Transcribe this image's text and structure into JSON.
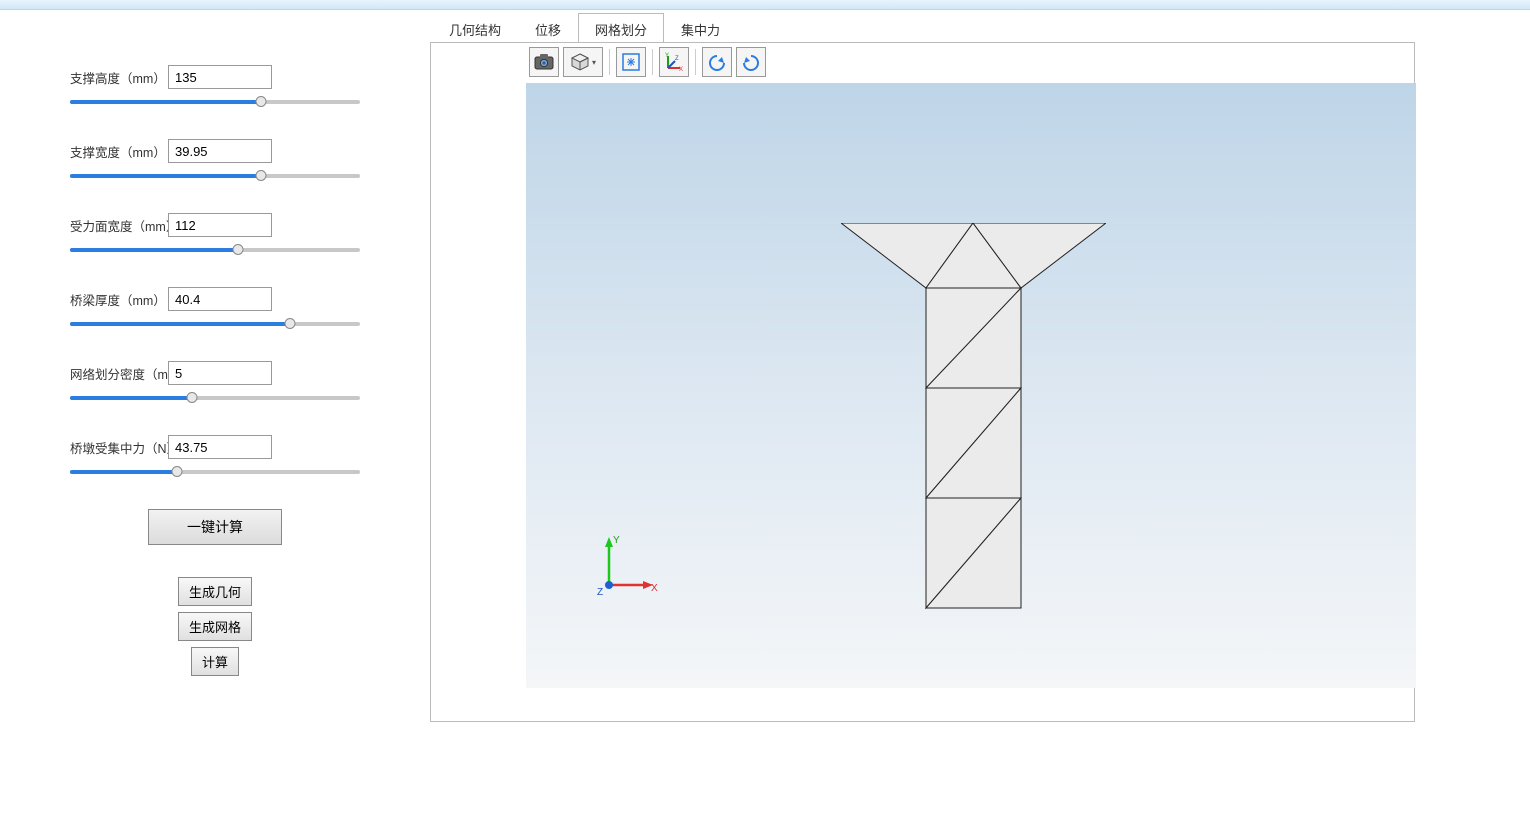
{
  "sidebar": {
    "params": [
      {
        "label": "支撑高度（mm）",
        "value": "135",
        "pct": 66
      },
      {
        "label": "支撑宽度（mm）",
        "value": "39.95",
        "pct": 66
      },
      {
        "label": "受力面宽度（mm）",
        "value": "112",
        "pct": 58
      },
      {
        "label": "桥梁厚度（mm）",
        "value": "40.4",
        "pct": 76
      },
      {
        "label": "网络划分密度（mm）",
        "value": "5",
        "pct": 42
      },
      {
        "label": "桥墩受集中力（N）",
        "value": "43.75",
        "pct": 37
      }
    ],
    "oneClick": "一键计算",
    "genGeom": "生成几何",
    "genMesh": "生成网格",
    "calc": "计算"
  },
  "tabs": {
    "items": [
      "几何结构",
      "位移",
      "网格划分",
      "集中力"
    ],
    "active": 2
  },
  "toolbar": {
    "icons": [
      "camera-icon",
      "cube-icon",
      "fit-icon",
      "axes-icon",
      "rotate-left-icon",
      "rotate-right-icon"
    ]
  },
  "axis": {
    "x": "X",
    "y": "Y",
    "z": "Z"
  }
}
